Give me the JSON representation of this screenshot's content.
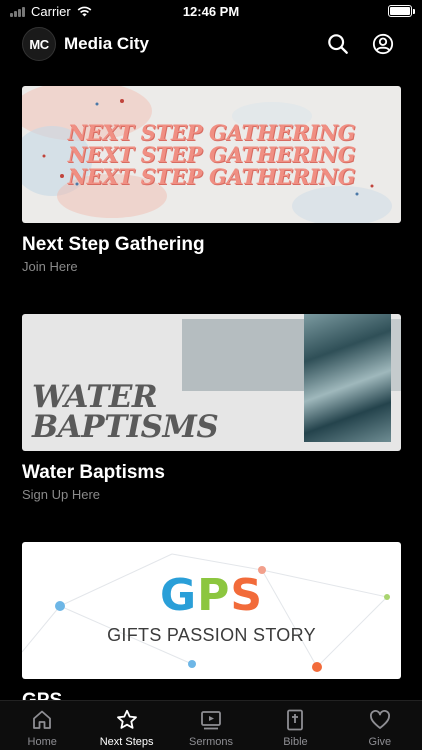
{
  "status_bar": {
    "carrier": "Carrier",
    "time": "12:46 PM",
    "battery_level": 1.0
  },
  "header": {
    "logo_text": "MC",
    "title": "Media City",
    "search_icon": "search-icon",
    "profile_icon": "user-circle-icon"
  },
  "cards": [
    {
      "banner_lines": [
        "NEXT STEP GATHERING",
        "NEXT STEP GATHERING",
        "NEXT STEP GATHERING"
      ],
      "title": "Next Step Gathering",
      "subtitle": "Join Here"
    },
    {
      "banner_lines": [
        "WATER",
        "BAPTISMS"
      ],
      "title": "Water Baptisms",
      "subtitle": "Sign Up Here"
    },
    {
      "banner_letters": [
        "G",
        "P",
        "S"
      ],
      "banner_subtitle": "GIFTS PASSION STORY",
      "title": "GPS"
    }
  ],
  "colors": {
    "gps_g": "#2a9fd8",
    "gps_p": "#8cc63f",
    "gps_s": "#f26b3a",
    "banner_text": "#f08f83"
  },
  "tabs": [
    {
      "label": "Home",
      "icon": "home-icon",
      "active": false
    },
    {
      "label": "Next Steps",
      "icon": "star-icon",
      "active": true
    },
    {
      "label": "Sermons",
      "icon": "video-icon",
      "active": false
    },
    {
      "label": "Bible",
      "icon": "bible-icon",
      "active": false
    },
    {
      "label": "Give",
      "icon": "heart-icon",
      "active": false
    }
  ]
}
